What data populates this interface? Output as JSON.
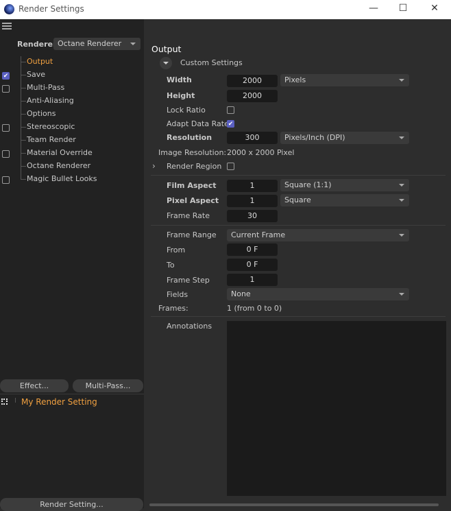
{
  "window": {
    "title": "Render Settings",
    "minimize": "—",
    "maximize": "☐",
    "close": "✕"
  },
  "sidebar": {
    "renderer_label": "Renderer",
    "renderer_value": "Octane Renderer",
    "items": [
      {
        "label": "Output",
        "checkbox": null,
        "active": true
      },
      {
        "label": "Save",
        "checkbox": true
      },
      {
        "label": "Multi-Pass",
        "checkbox": false
      },
      {
        "label": "Anti-Aliasing",
        "checkbox": null
      },
      {
        "label": "Options",
        "checkbox": null
      },
      {
        "label": "Stereoscopic",
        "checkbox": false
      },
      {
        "label": "Team Render",
        "checkbox": null
      },
      {
        "label": "Material Override",
        "checkbox": false
      },
      {
        "label": "Octane Renderer",
        "checkbox": null
      },
      {
        "label": "Magic Bullet Looks",
        "checkbox": false
      }
    ],
    "effect_button": "Effect...",
    "multipass_button": "Multi-Pass...",
    "setting_name": "My Render Setting",
    "render_setting_button": "Render Setting...",
    "accent": "#f0a040"
  },
  "main": {
    "title": "Output",
    "preset": "Custom Settings",
    "width_label": "Width",
    "width": "2000",
    "width_unit": "Pixels",
    "height_label": "Height",
    "height": "2000",
    "lock_ratio_label": "Lock Ratio",
    "lock_ratio": false,
    "adapt_label": "Adapt Data Rate",
    "adapt": true,
    "resolution_label": "Resolution",
    "resolution": "300",
    "resolution_unit": "Pixels/Inch (DPI)",
    "image_res_label": "Image Resolution:",
    "image_res": "2000 x 2000 Pixel",
    "render_region_label": "Render Region",
    "render_region": false,
    "film_aspect_label": "Film Aspect",
    "film_aspect": "1",
    "film_aspect_preset": "Square (1:1)",
    "pixel_aspect_label": "Pixel Aspect",
    "pixel_aspect": "1",
    "pixel_aspect_preset": "Square",
    "frame_rate_label": "Frame Rate",
    "frame_rate": "30",
    "frame_range_label": "Frame Range",
    "frame_range": "Current Frame",
    "from_label": "From",
    "from": "0 F",
    "to_label": "To",
    "to": "0 F",
    "frame_step_label": "Frame Step",
    "frame_step": "1",
    "fields_label": "Fields",
    "fields": "None",
    "frames_label": "Frames:",
    "frames": "1 (from 0 to 0)",
    "annotations_label": "Annotations",
    "annotations": ""
  }
}
